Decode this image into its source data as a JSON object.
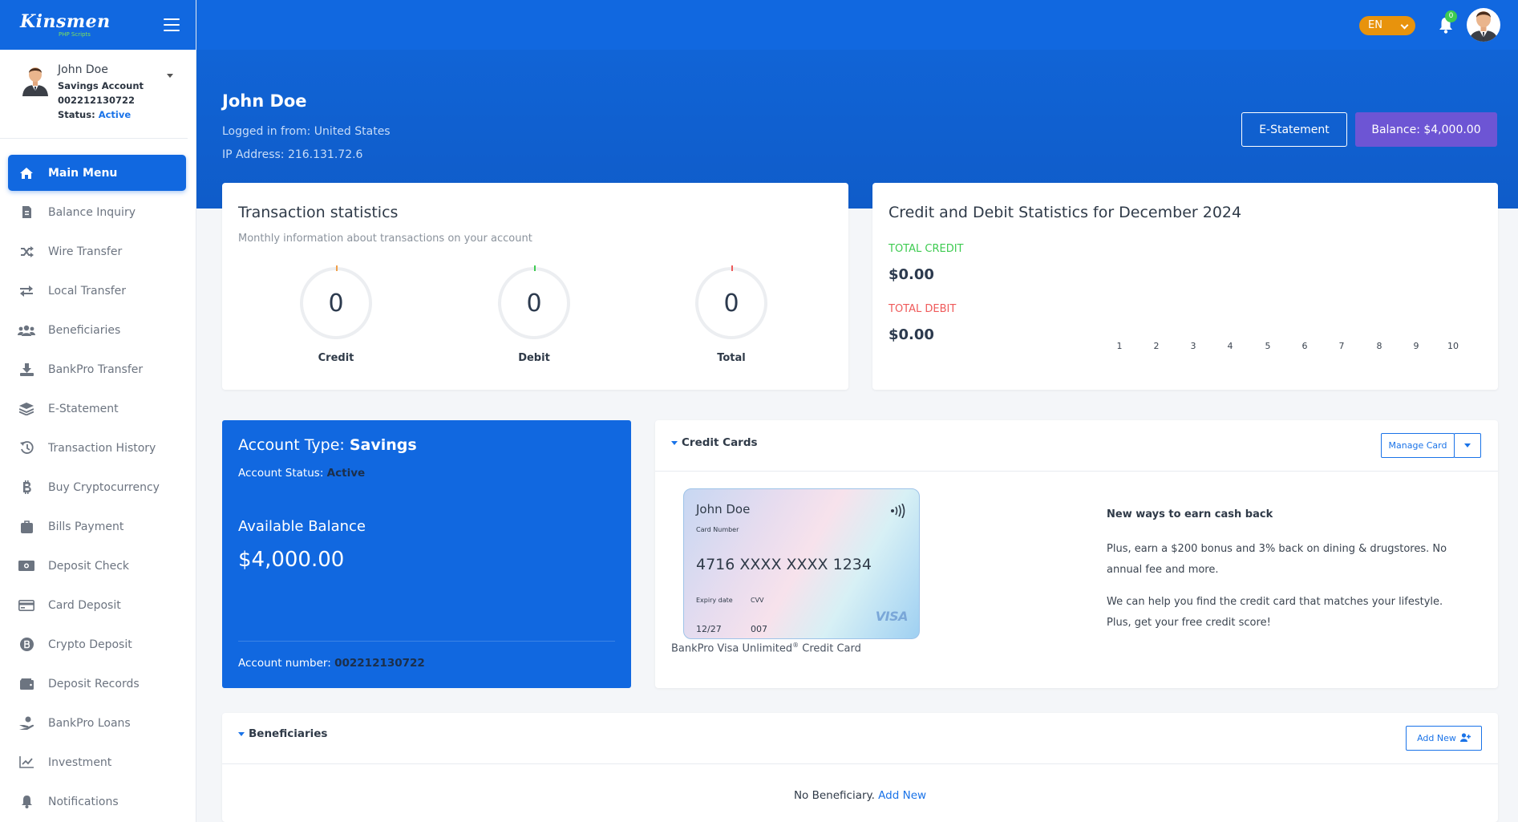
{
  "brand": {
    "name": "Kinsmen",
    "tagline": "PHP Scripts"
  },
  "sidebar": {
    "user": {
      "name": "John Doe",
      "account_type": "Savings Account",
      "account_number": "002212130722",
      "status_label": "Status:",
      "status": "Active"
    },
    "items": [
      {
        "label": "Main Menu",
        "icon": "home-icon",
        "active": true
      },
      {
        "label": "Balance Inquiry",
        "icon": "invoice-icon"
      },
      {
        "label": "Wire Transfer",
        "icon": "shuffle-icon"
      },
      {
        "label": "Local Transfer",
        "icon": "exchange-icon"
      },
      {
        "label": "Beneficiaries",
        "icon": "users-icon"
      },
      {
        "label": "BankPro Transfer",
        "icon": "download-icon"
      },
      {
        "label": "E-Statement",
        "icon": "layers-icon"
      },
      {
        "label": "Transaction History",
        "icon": "history-icon"
      },
      {
        "label": "Buy Cryptocurrency",
        "icon": "bitcoin-icon"
      },
      {
        "label": "Bills Payment",
        "icon": "briefcase-icon"
      },
      {
        "label": "Deposit Check",
        "icon": "money-bill-icon"
      },
      {
        "label": "Card Deposit",
        "icon": "credit-card-icon"
      },
      {
        "label": "Crypto Deposit",
        "icon": "bitcoin-circle-icon"
      },
      {
        "label": "Deposit Records",
        "icon": "wallet-icon"
      },
      {
        "label": "BankPro Loans",
        "icon": "hand-coin-icon"
      },
      {
        "label": "Investment",
        "icon": "chart-line-icon"
      },
      {
        "label": "Notifications",
        "icon": "bell-icon"
      }
    ]
  },
  "topbar": {
    "language": "EN",
    "notification_count": "0"
  },
  "hero": {
    "name": "John Doe",
    "login_from": "Logged in from: United States",
    "ip": "IP Address: 216.131.72.6",
    "estatement_button": "E-Statement",
    "balance_button": "Balance: $4,000.00"
  },
  "transaction_stats": {
    "title": "Transaction statistics",
    "subtitle": "Monthly information about transactions on your account",
    "items": [
      {
        "label": "Credit",
        "value": "0",
        "color": "#f0a04b"
      },
      {
        "label": "Debit",
        "value": "0",
        "color": "#3ecb51"
      },
      {
        "label": "Total",
        "value": "0",
        "color": "#ef5a5a"
      }
    ]
  },
  "credit_debit": {
    "title": "Credit and Debit Statistics for December 2024",
    "total_credit_label": "TOTAL CREDIT",
    "total_credit": "$0.00",
    "total_debit_label": "TOTAL DEBIT",
    "total_debit": "$0.00",
    "axis": [
      "1",
      "2",
      "3",
      "4",
      "5",
      "6",
      "7",
      "8",
      "9",
      "10"
    ],
    "credit_color": "#3ecb51",
    "debit_color": "#ef5a5a"
  },
  "account_card": {
    "type_label": "Account Type:",
    "type": "Savings",
    "status_label": "Account Status:",
    "status": "Active",
    "balance_label": "Available Balance",
    "balance": "$4,000.00",
    "number_label": "Account number:",
    "number": "002212130722"
  },
  "credit_cards": {
    "title": "Credit Cards",
    "manage_button": "Manage Card",
    "card": {
      "holder": "John Doe",
      "number_label": "Card Number",
      "number": "4716 XXXX XXXX 1234",
      "expiry_label": "Expiry date",
      "expiry": "12/27",
      "cvv_label": "CVV",
      "cvv": "007",
      "network": "VISA"
    },
    "caption": "BankPro Visa Unlimited",
    "caption_mark": "®",
    "caption_suffix": "Credit Card",
    "promo_title": "New ways to earn cash back",
    "promo_1": "Plus, earn a $200 bonus and 3% back on dining & drugstores. No annual fee and more.",
    "promo_2": "We can help you find the credit card that matches your lifestyle. Plus, get your free credit score!"
  },
  "beneficiaries": {
    "title": "Beneficiaries",
    "add_button": "Add New",
    "empty_text": "No Beneficiary.",
    "empty_link": "Add New"
  }
}
